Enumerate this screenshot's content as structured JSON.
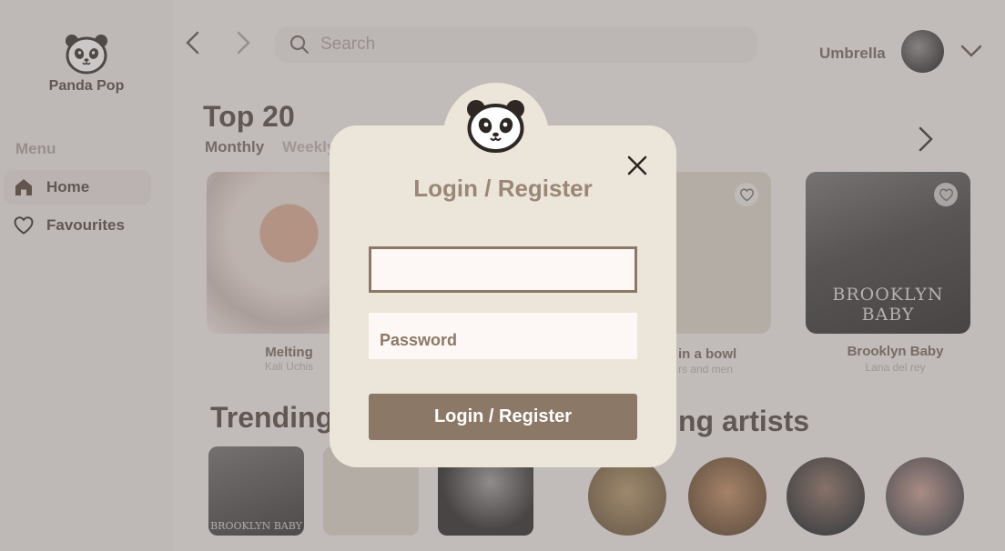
{
  "app": {
    "brand": "Panda Pop"
  },
  "sidebar": {
    "menu_label": "Menu",
    "items": [
      {
        "label": "Home",
        "icon": "home-icon",
        "active": true
      },
      {
        "label": "Favourites",
        "icon": "heart-icon",
        "active": false
      }
    ]
  },
  "topbar": {
    "search_placeholder": "Search",
    "user_name": "Umbrella"
  },
  "top20": {
    "heading": "Top 20",
    "tabs": [
      "Monthly",
      "Weekly"
    ],
    "cards": [
      {
        "title": "Melting",
        "artist": "Kali Uchis"
      },
      {
        "title": "in a bowl",
        "artist": "rs and men"
      },
      {
        "title": "Brooklyn Baby",
        "artist": "Lana del rey"
      }
    ],
    "cover_text": "BROOKLYN BABY"
  },
  "trending": {
    "heading": "Trending",
    "mini_cover_text": "BROOKLYN BABY"
  },
  "artists": {
    "heading": "ng artists"
  },
  "modal": {
    "title": "Login / Register",
    "username_value": "",
    "password_placeholder": "Password",
    "submit_label": "Login / Register"
  },
  "colors": {
    "accent_brown": "#8c7866",
    "modal_bg": "#ece5d9",
    "title_brown": "#9a8776",
    "text_dark": "#4a403a"
  }
}
